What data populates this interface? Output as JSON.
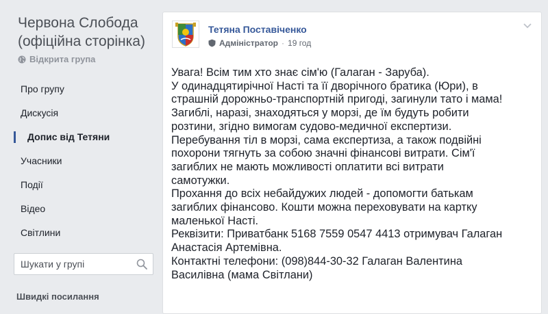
{
  "group": {
    "title": "Червона Слобода (офіційна сторінка)",
    "type": "Відкрита група"
  },
  "nav": [
    {
      "label": "Про групу"
    },
    {
      "label": "Дискусія"
    },
    {
      "label": "Допис від Тетяни",
      "active": true
    },
    {
      "label": "Учасники"
    },
    {
      "label": "Події"
    },
    {
      "label": "Відео"
    },
    {
      "label": "Світлини"
    }
  ],
  "search": {
    "placeholder": "Шукати у групі"
  },
  "quick_links": {
    "label": "Швидкі посилання"
  },
  "post": {
    "author": "Тетяна Поставіченко",
    "role": "Адміністратор",
    "separator": "·",
    "time": "19 год",
    "lines": [
      "Увага! Всім тим хто знає сім'ю (Галаган - Заруба).",
      "У одинадцятирічної Насті та її дворічного братика (Юри), в",
      "страшній дорожньо-транспортній пригоді, загинули тато і мама!",
      "Загиблі, наразі, знаходяться у морзі, де їм будуть робити",
      "розтини, згідно вимогам судово-медичної експертизи.",
      "Перебування тіл в морзі, сама експертиза, а також подвійні",
      "похорони тягнуть за собою значні фінансові витрати. Сім'ї",
      "загиблих не мають можливості оплатити всі витрати",
      "самотужки.",
      "Прохання до всіх небайдужих людей - допомогти батькам",
      "загиблих фінансово. Кошти можна переховувати на картку",
      "маленької Насті.",
      "Реквізити: Приватбанк 5168 7559 0547 4413 отримувач Галаган",
      "Анастасія Артемівна.",
      "Контактні телефони: (098)844-30-32 Галаган Валентина",
      "Василівна (мама Світлани)"
    ]
  },
  "colors": {
    "page_bg": "#e9ebee",
    "link": "#365899",
    "text": "#1d2129",
    "muted": "#90949c"
  }
}
